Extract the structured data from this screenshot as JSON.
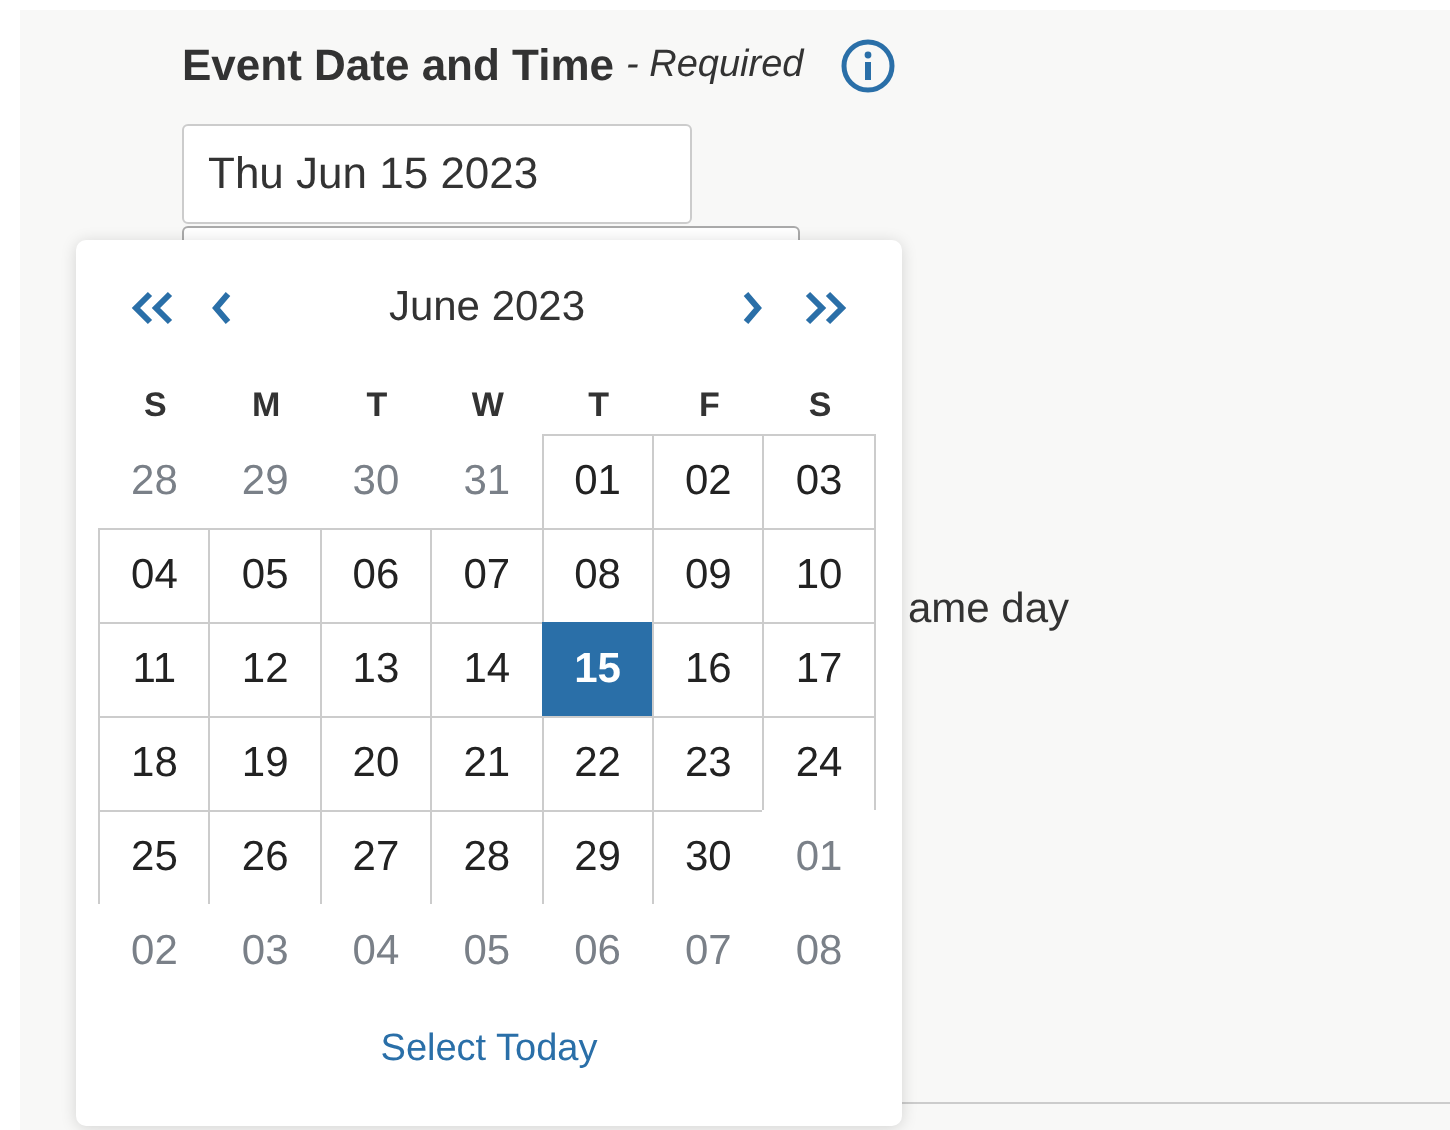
{
  "field": {
    "label": "Event Date and Time",
    "hint": "- Required",
    "value": "Thu Jun 15 2023"
  },
  "behind_text": "ame day",
  "calendar": {
    "title": "June 2023",
    "weekdays": [
      "S",
      "M",
      "T",
      "W",
      "T",
      "F",
      "S"
    ],
    "days": [
      {
        "label": "28",
        "outside": true,
        "selected": false
      },
      {
        "label": "29",
        "outside": true,
        "selected": false
      },
      {
        "label": "30",
        "outside": true,
        "selected": false
      },
      {
        "label": "31",
        "outside": true,
        "selected": false
      },
      {
        "label": "01",
        "outside": false,
        "selected": false
      },
      {
        "label": "02",
        "outside": false,
        "selected": false
      },
      {
        "label": "03",
        "outside": false,
        "selected": false
      },
      {
        "label": "04",
        "outside": false,
        "selected": false
      },
      {
        "label": "05",
        "outside": false,
        "selected": false
      },
      {
        "label": "06",
        "outside": false,
        "selected": false
      },
      {
        "label": "07",
        "outside": false,
        "selected": false
      },
      {
        "label": "08",
        "outside": false,
        "selected": false
      },
      {
        "label": "09",
        "outside": false,
        "selected": false
      },
      {
        "label": "10",
        "outside": false,
        "selected": false
      },
      {
        "label": "11",
        "outside": false,
        "selected": false
      },
      {
        "label": "12",
        "outside": false,
        "selected": false
      },
      {
        "label": "13",
        "outside": false,
        "selected": false
      },
      {
        "label": "14",
        "outside": false,
        "selected": false
      },
      {
        "label": "15",
        "outside": false,
        "selected": true
      },
      {
        "label": "16",
        "outside": false,
        "selected": false
      },
      {
        "label": "17",
        "outside": false,
        "selected": false
      },
      {
        "label": "18",
        "outside": false,
        "selected": false
      },
      {
        "label": "19",
        "outside": false,
        "selected": false
      },
      {
        "label": "20",
        "outside": false,
        "selected": false
      },
      {
        "label": "21",
        "outside": false,
        "selected": false
      },
      {
        "label": "22",
        "outside": false,
        "selected": false
      },
      {
        "label": "23",
        "outside": false,
        "selected": false
      },
      {
        "label": "24",
        "outside": false,
        "selected": false
      },
      {
        "label": "25",
        "outside": false,
        "selected": false
      },
      {
        "label": "26",
        "outside": false,
        "selected": false
      },
      {
        "label": "27",
        "outside": false,
        "selected": false
      },
      {
        "label": "28",
        "outside": false,
        "selected": false
      },
      {
        "label": "29",
        "outside": false,
        "selected": false
      },
      {
        "label": "30",
        "outside": false,
        "selected": false
      },
      {
        "label": "01",
        "outside": true,
        "selected": false
      },
      {
        "label": "02",
        "outside": true,
        "selected": false
      },
      {
        "label": "03",
        "outside": true,
        "selected": false
      },
      {
        "label": "04",
        "outside": true,
        "selected": false
      },
      {
        "label": "05",
        "outside": true,
        "selected": false
      },
      {
        "label": "06",
        "outside": true,
        "selected": false
      },
      {
        "label": "07",
        "outside": true,
        "selected": false
      },
      {
        "label": "08",
        "outside": true,
        "selected": false
      }
    ],
    "today_link": "Select Today"
  }
}
